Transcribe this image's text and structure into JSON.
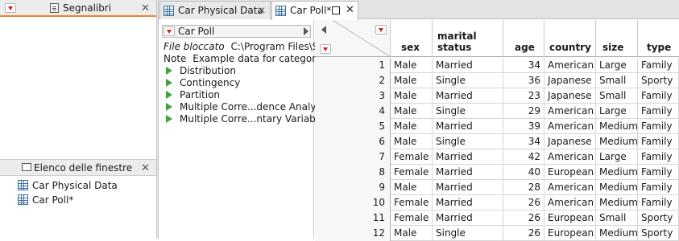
{
  "bookmarks_panel": {
    "title": "Segnalibri"
  },
  "windows_panel": {
    "title": "Elenco delle finestre",
    "items": [
      {
        "label": "Car Physical Data"
      },
      {
        "label": "Car Poll*"
      }
    ]
  },
  "tabs": [
    {
      "label": "Car Physical Data",
      "active": false
    },
    {
      "label": "Car Poll*",
      "active": true
    }
  ],
  "table_panel": {
    "title": "Car Poll",
    "file_label": "File bloccato",
    "file_path": "C:\\Program Files\\SAS",
    "note_label": "Note",
    "note_text": "Example data for categorical",
    "scripts": [
      {
        "label": "Distribution"
      },
      {
        "label": "Contingency"
      },
      {
        "label": "Partition"
      },
      {
        "label": "Multiple Corre...dence Analysis"
      },
      {
        "label": "Multiple Corre...ntary Variable"
      }
    ]
  },
  "grid": {
    "columns": [
      "sex",
      "marital status",
      "age",
      "country",
      "size",
      "type"
    ],
    "rows": [
      {
        "n": "1",
        "sex": "Male",
        "marital": "Married",
        "age": "34",
        "country": "American",
        "size": "Large",
        "type": "Family"
      },
      {
        "n": "2",
        "sex": "Male",
        "marital": "Single",
        "age": "36",
        "country": "Japanese",
        "size": "Small",
        "type": "Sporty"
      },
      {
        "n": "3",
        "sex": "Male",
        "marital": "Married",
        "age": "23",
        "country": "Japanese",
        "size": "Small",
        "type": "Family"
      },
      {
        "n": "4",
        "sex": "Male",
        "marital": "Single",
        "age": "29",
        "country": "American",
        "size": "Large",
        "type": "Family"
      },
      {
        "n": "5",
        "sex": "Male",
        "marital": "Married",
        "age": "39",
        "country": "American",
        "size": "Medium",
        "type": "Family"
      },
      {
        "n": "6",
        "sex": "Male",
        "marital": "Single",
        "age": "34",
        "country": "Japanese",
        "size": "Medium",
        "type": "Family"
      },
      {
        "n": "7",
        "sex": "Female",
        "marital": "Married",
        "age": "42",
        "country": "American",
        "size": "Large",
        "type": "Family"
      },
      {
        "n": "8",
        "sex": "Female",
        "marital": "Married",
        "age": "40",
        "country": "European",
        "size": "Medium",
        "type": "Family"
      },
      {
        "n": "9",
        "sex": "Male",
        "marital": "Married",
        "age": "28",
        "country": "American",
        "size": "Medium",
        "type": "Family"
      },
      {
        "n": "10",
        "sex": "Female",
        "marital": "Married",
        "age": "26",
        "country": "American",
        "size": "Medium",
        "type": "Family"
      },
      {
        "n": "11",
        "sex": "Female",
        "marital": "Married",
        "age": "26",
        "country": "European",
        "size": "Small",
        "type": "Sporty"
      },
      {
        "n": "12",
        "sex": "Male",
        "marital": "Single",
        "age": "26",
        "country": "European",
        "size": "Medium",
        "type": "Sporty"
      }
    ]
  },
  "colors": {
    "accent": "#f08030",
    "dropdown_red": "#d22020",
    "script_green": "#3fa33f",
    "table_icon_blue": "#3a6ea5"
  }
}
